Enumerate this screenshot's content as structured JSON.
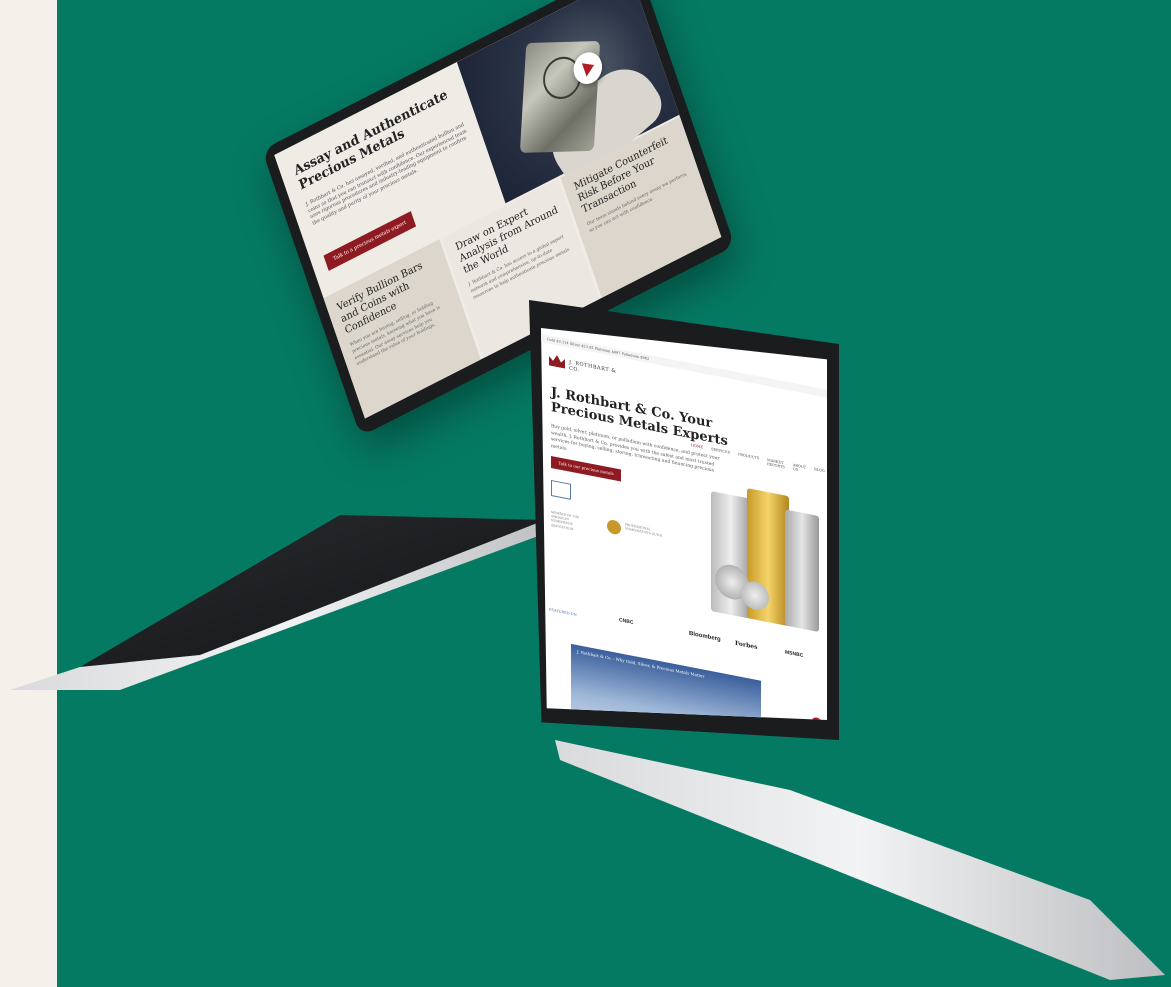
{
  "colors": {
    "background": "#057a63",
    "margin": "#f4f1eb",
    "accent_red": "#8e1b22",
    "gold": "#c79a28"
  },
  "laptop_back": {
    "hero": {
      "title": "Assay and Authenticate Precious Metals",
      "body": "J. Rothbart & Co. has assayed, verified, and authenticated bullion and coins so that you can transact with confidence. Our experienced team uses rigorous procedures and industry-leading equipment to confirm the quality and purity of your precious metals.",
      "button": "Talk to a precious metals expert"
    },
    "cards": [
      {
        "title": "Verify Bullion Bars and Coins with Confidence",
        "body": "When you are buying, selling, or holding precious metals, knowing what you have is essential. Our assay services help you understand the value of your holdings."
      },
      {
        "title": "Draw on Expert Analysis from Around the World",
        "body": "J. Rothbart & Co. has access to a global expert network and comprehensive, up-to-date resources to help authenticate precious metals."
      },
      {
        "title": "Mitigate Counterfeit Risk Before Your Transaction",
        "body": "Our team stands behind every assay we perform, so you can act with confidence."
      }
    ]
  },
  "laptop_front": {
    "topbar": "Gold $2,114  Silver $23.05  Platinum $897  Palladium $962",
    "logo": "J. ROTHBART & CO.",
    "nav": [
      "HOME",
      "SERVICES",
      "PRODUCTS",
      "MARKET REPORTS",
      "ABOUT US",
      "BLOG"
    ],
    "hero_title": "J. Rothbart & Co. Your Precious Metals Experts",
    "hero_body": "Buy gold, silver, platinum, or palladium with confidence, and protect your wealth. J. Rothbart & Co. provides you with the safest and most trusted services for buying, selling, storing, transacting and financing precious metals.",
    "hero_button": "Talk to our precious metals experts",
    "badge_text_1": "MEMBER OF THE AMERICAN NUMISMATIC ASSOCIATION",
    "badge_text_2": "PROFESSIONAL NUMISMATISTS GUILD",
    "featured_label": "FEATURED ON",
    "featured_logos": [
      "CNBC",
      "Bloomberg",
      "Forbes",
      "MSNBC"
    ],
    "video_title": "J. Rothbart & Co. - Why Gold, Silver, & Precious Metals Matter"
  }
}
